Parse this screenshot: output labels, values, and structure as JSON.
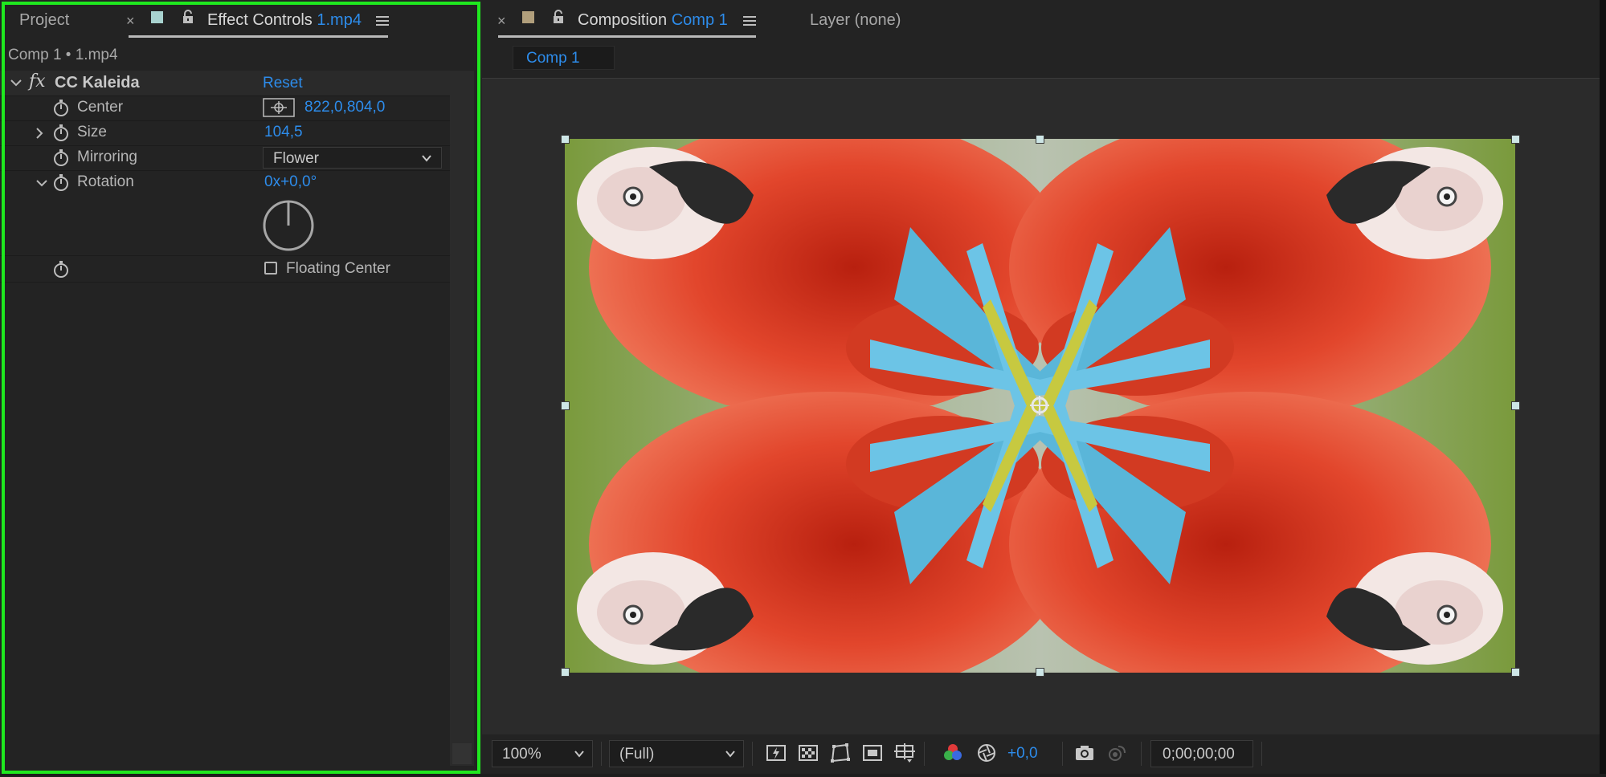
{
  "left_panel": {
    "tab_project": "Project",
    "tab_effect_controls": "Effect Controls",
    "tab_effect_controls_file": "1.mp4",
    "subtitle": "Comp 1 • 1.mp4",
    "effect": {
      "fx_label": "fx",
      "name": "CC Kaleida",
      "reset": "Reset"
    },
    "properties": {
      "center_label": "Center",
      "center_value": "822,0,804,0",
      "size_label": "Size",
      "size_value": "104,5",
      "mirroring_label": "Mirroring",
      "mirroring_value": "Flower",
      "rotation_label": "Rotation",
      "rotation_value": "0x+0,0°",
      "floating_center_label": "Floating Center"
    }
  },
  "right_panel": {
    "tab_composition": "Composition",
    "tab_composition_name": "Comp 1",
    "tab_layer": "Layer (none)",
    "comp_chip": "Comp 1",
    "footer": {
      "zoom": "100%",
      "resolution": "(Full)",
      "exposure": "+0,0",
      "timecode": "0;00;00;00"
    }
  },
  "colors": {
    "accent_blue": "#2d8ceb",
    "highlight_green": "#1fe81f",
    "panel_bg": "#232323"
  },
  "icons": [
    "close-icon",
    "label-color-icon",
    "lock-icon",
    "panel-menu-icon",
    "fx-icon",
    "stopwatch-icon",
    "position-target-icon",
    "chevron-down-icon",
    "snapshot-camera-icon",
    "color-channels-icon",
    "exposure-icon",
    "fast-preview-icon",
    "transparency-grid-icon",
    "mask-path-icon",
    "region-of-interest-icon",
    "grid-guides-icon"
  ]
}
